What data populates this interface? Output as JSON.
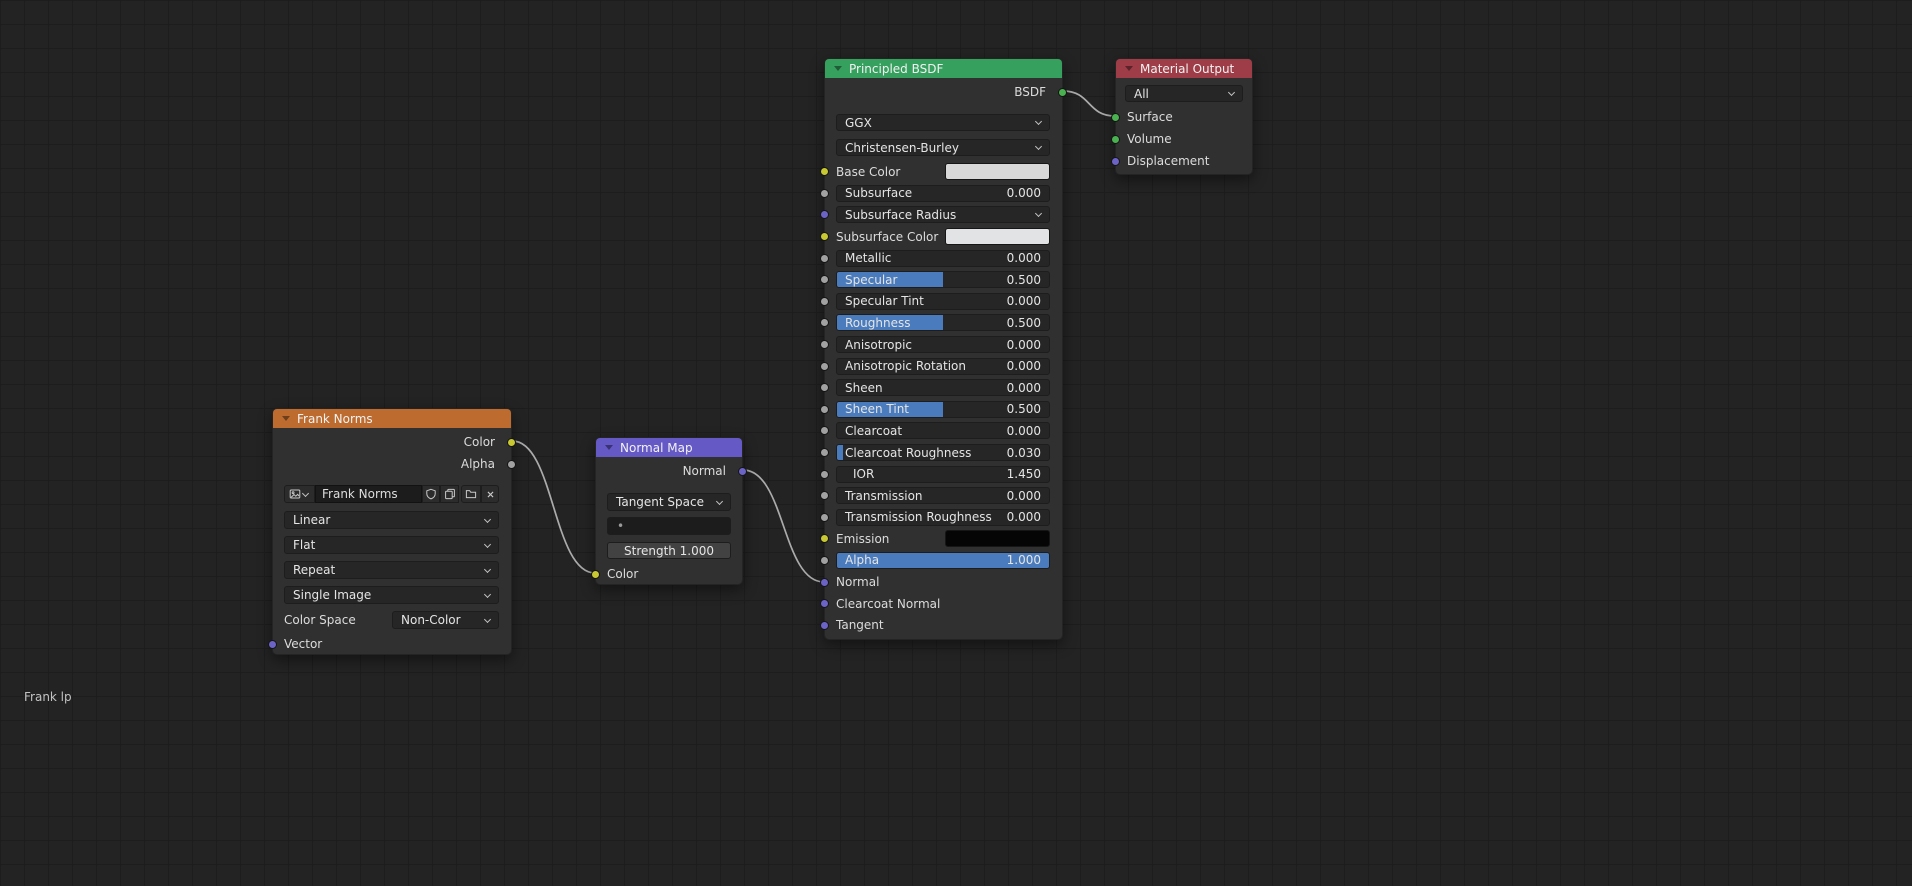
{
  "footer": {
    "label": "Frank lp"
  },
  "colors": {
    "background": "#232323",
    "grid_line": "#1d1d1d",
    "node_body": "#303030",
    "header_texture": "#bd6b2f",
    "header_vector": "#6559c6",
    "header_shader": "#36a05e",
    "header_output": "#9e3d47",
    "widget_bg": "#262626",
    "slider_fill": "#4a7bbd",
    "wire": "#b3b3b3",
    "socket_color": "#c8c832",
    "socket_value": "#a1a1a1",
    "socket_vector": "#6c63c7",
    "socket_shader": "#4ab150"
  },
  "icons": {
    "collapse": "triangle-down",
    "dropdown": "chevron-down",
    "image_browse": "image",
    "fake_user": "shield",
    "new_image": "duplicate",
    "open_image": "folder",
    "unlink": "x"
  },
  "image_texture_node": {
    "title": "Frank Norms",
    "outputs": {
      "color": "Color",
      "alpha": "Alpha"
    },
    "image_name": "Frank Norms",
    "interpolation": "Linear",
    "projection": "Flat",
    "extension": "Repeat",
    "source": "Single Image",
    "color_space_label": "Color Space",
    "color_space_value": "Non-Color",
    "input_vector": "Vector"
  },
  "normal_map_node": {
    "title": "Normal Map",
    "output_normal": "Normal",
    "space": "Tangent Space",
    "uv_map": "•",
    "strength_label": "Strength",
    "strength_value": "1.000",
    "input_color": "Color"
  },
  "principled_node": {
    "title": "Principled BSDF",
    "output_bsdf": "BSDF",
    "distribution": "GGX",
    "subsurface_method": "Christensen-Burley",
    "rows": [
      {
        "label": "Base Color",
        "type": "color",
        "swatch": "#d8d8d8",
        "socket": "color"
      },
      {
        "label": "Subsurface",
        "value": "0.000",
        "type": "slider",
        "socket": "value"
      },
      {
        "label": "Subsurface Radius",
        "type": "vector",
        "socket": "vector"
      },
      {
        "label": "Subsurface Color",
        "type": "color",
        "swatch": "#e2e3e4",
        "socket": "color"
      },
      {
        "label": "Metallic",
        "value": "0.000",
        "type": "slider",
        "socket": "value"
      },
      {
        "label": "Specular",
        "value": "0.500",
        "type": "slider",
        "fill": "50%",
        "socket": "value"
      },
      {
        "label": "Specular Tint",
        "value": "0.000",
        "type": "slider",
        "socket": "value"
      },
      {
        "label": "Roughness",
        "value": "0.500",
        "type": "slider",
        "fill": "50%",
        "socket": "value"
      },
      {
        "label": "Anisotropic",
        "value": "0.000",
        "type": "slider",
        "socket": "value"
      },
      {
        "label": "Anisotropic Rotation",
        "value": "0.000",
        "type": "slider",
        "socket": "value"
      },
      {
        "label": "Sheen",
        "value": "0.000",
        "type": "slider",
        "socket": "value"
      },
      {
        "label": "Sheen Tint",
        "value": "0.500",
        "type": "slider",
        "fill": "50%",
        "socket": "value"
      },
      {
        "label": "Clearcoat",
        "value": "0.000",
        "type": "slider",
        "socket": "value"
      },
      {
        "label": "Clearcoat Roughness",
        "value": "0.030",
        "type": "slider",
        "fill": "3%",
        "socket": "value"
      },
      {
        "label": "IOR",
        "value": "1.450",
        "type": "slider",
        "socket": "value"
      },
      {
        "label": "Transmission",
        "value": "0.000",
        "type": "slider",
        "socket": "value"
      },
      {
        "label": "Transmission Roughness",
        "value": "0.000",
        "type": "slider",
        "socket": "value"
      },
      {
        "label": "Emission",
        "type": "color",
        "swatch": "#050505",
        "socket": "color"
      },
      {
        "label": "Alpha",
        "value": "1.000",
        "type": "slider",
        "fill": "100%",
        "socket": "value"
      },
      {
        "label": "Normal",
        "type": "input",
        "socket": "vector"
      },
      {
        "label": "Clearcoat Normal",
        "type": "input",
        "socket": "vector"
      },
      {
        "label": "Tangent",
        "type": "input",
        "socket": "vector"
      }
    ]
  },
  "material_output_node": {
    "title": "Material Output",
    "target": "All",
    "inputs": [
      {
        "label": "Surface",
        "socket": "shader"
      },
      {
        "label": "Volume",
        "socket": "shader"
      },
      {
        "label": "Displacement",
        "socket": "vector"
      }
    ]
  },
  "links": [
    {
      "from": "Frank Norms.Color",
      "to": "Normal Map.Color"
    },
    {
      "from": "Normal Map.Normal",
      "to": "Principled BSDF.Normal"
    },
    {
      "from": "Principled BSDF.BSDF",
      "to": "Material Output.Surface"
    }
  ]
}
